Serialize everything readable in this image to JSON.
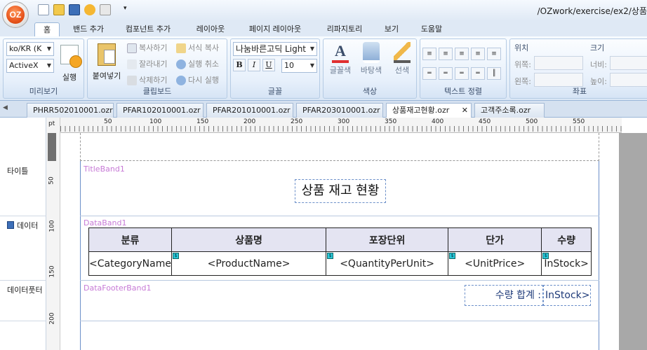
{
  "window": {
    "path": "/OZwork/exercise/ex2/상품",
    "logo_text": "OZ"
  },
  "menu_tabs": [
    "홈",
    "밴드 추가",
    "컴포넌트 추가",
    "레이아웃",
    "페이지 레이아웃",
    "리파지토리",
    "보기",
    "도움말"
  ],
  "ribbon": {
    "preview": {
      "lang": "ko/KR",
      "lang_sel": "(K",
      "mode": "ActiveX",
      "run_label": "실행",
      "group_label": "미리보기"
    },
    "clipboard": {
      "paste": "붙여넣기",
      "copy": "복사하기",
      "cut": "잘라내기",
      "delete": "삭제하기",
      "format_copy": "서식 복사",
      "undo": "실행 취소",
      "redo": "다시 실행",
      "group_label": "클립보드"
    },
    "font": {
      "name": "나눔바른고딕 Light",
      "size": "10",
      "bold": "B",
      "italic": "I",
      "underline": "U",
      "group_label": "글꼴"
    },
    "color": {
      "font_color": "글꼴색",
      "bg_color": "바탕색",
      "line_color": "선색",
      "group_label": "색상"
    },
    "align": {
      "group_label": "텍스트 정렬"
    },
    "coord": {
      "position": "위치",
      "size": "크기",
      "top": "위쪽:",
      "left": "왼쪽:",
      "width": "너비:",
      "height": "높이:",
      "group_label": "좌표"
    }
  },
  "doc_tabs": [
    "PHRR502010001.ozr",
    "PFAR102010001.ozr",
    "PFAR201010001.ozr",
    "PFAR203010001.ozr",
    "상품재고현황.ozr",
    "고객주소록.ozr"
  ],
  "active_doc_tab": "상품재고현황.ozr",
  "ruler": {
    "unit": "pt",
    "h_ticks": [
      "50",
      "100",
      "150",
      "200",
      "250",
      "300",
      "350",
      "400",
      "450",
      "500",
      "550"
    ],
    "v_ticks": [
      "50",
      "100",
      "150",
      "200"
    ]
  },
  "bands": [
    {
      "label": "타이틀",
      "name": "TitleBand1"
    },
    {
      "label": "데이터",
      "name": "DataBand1"
    },
    {
      "label": "데이터풋터",
      "name": "DataFooterBand1"
    }
  ],
  "report": {
    "title": "상품 재고 현황",
    "columns": [
      "분류",
      "상품명",
      "포장단위",
      "단가",
      "수량"
    ],
    "fields": [
      "<CategoryName",
      "<ProductName>",
      "<QuantityPerUnit>",
      "<UnitPrice>",
      "InStock>"
    ],
    "footer_label": "수량 합계 :",
    "footer_field": "InStock>"
  }
}
